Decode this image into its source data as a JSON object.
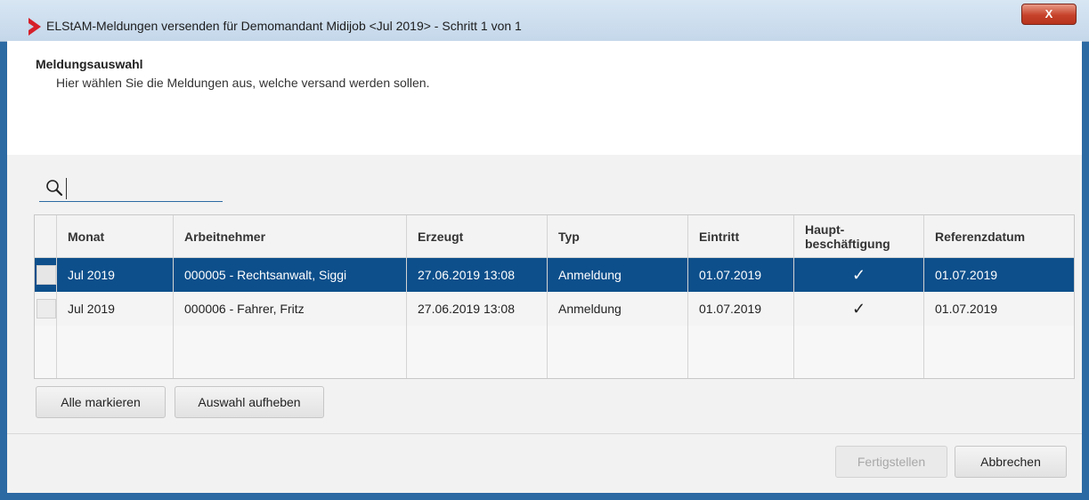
{
  "window": {
    "title": "ELStAM-Meldungen versenden für Demomandant Midijob <Jul 2019> - Schritt 1 von 1",
    "close_label": "X"
  },
  "header": {
    "title": "Meldungsauswahl",
    "subtitle": "Hier wählen Sie die Meldungen aus, welche versand werden sollen."
  },
  "search": {
    "value": "",
    "placeholder": ""
  },
  "table": {
    "columns": [
      "Monat",
      "Arbeitnehmer",
      "Erzeugt",
      "Typ",
      "Eintritt",
      "Haupt-\nbeschäftigung",
      "Referenzdatum"
    ],
    "column_header_haupt_line1": "Haupt-",
    "column_header_haupt_line2": "beschäftigung",
    "rows": [
      {
        "monat": "Jul 2019",
        "arbeitnehmer": "000005 - Rechtsanwalt, Siggi",
        "erzeugt": "27.06.2019 13:08",
        "typ": "Anmeldung",
        "eintritt": "01.07.2019",
        "haupt": "✓",
        "referenzdatum": "01.07.2019",
        "selected": true
      },
      {
        "monat": "Jul 2019",
        "arbeitnehmer": "000006 - Fahrer, Fritz",
        "erzeugt": "27.06.2019 13:08",
        "typ": "Anmeldung",
        "eintritt": "01.07.2019",
        "haupt": "✓",
        "referenzdatum": "01.07.2019",
        "selected": false
      }
    ]
  },
  "buttons": {
    "select_all": "Alle markieren",
    "clear_selection": "Auswahl aufheben",
    "finish": "Fertigstellen",
    "cancel": "Abbrechen"
  },
  "colors": {
    "selected_row": "#0d4f8b",
    "window_border": "#2c6aa3",
    "title_logo": "#d6202a"
  }
}
